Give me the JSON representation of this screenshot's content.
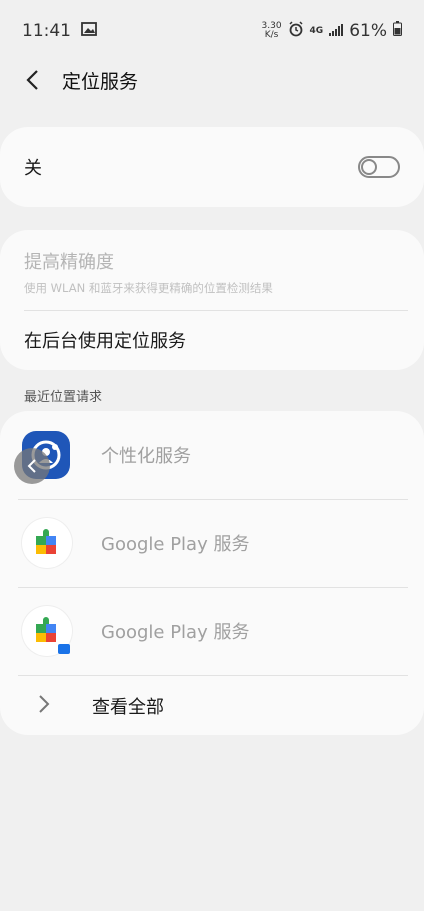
{
  "status_bar": {
    "time": "11:41",
    "net_speed_value": "3.30",
    "net_speed_unit": "K/s",
    "network_type": "4G",
    "battery": "61%"
  },
  "app_bar": {
    "title": "定位服务"
  },
  "location_toggle": {
    "label": "关",
    "state": "off"
  },
  "accuracy": {
    "title": "提高精确度",
    "subtitle": "使用 WLAN 和蓝牙来获得更精确的位置检测结果"
  },
  "background_use": {
    "label": "在后台使用定位服务"
  },
  "recent_requests": {
    "section_label": "最近位置请求",
    "apps": [
      {
        "name": "个性化服务",
        "icon": "personalization-icon"
      },
      {
        "name": "Google Play 服务",
        "icon": "google-play-services-icon"
      },
      {
        "name": "Google Play 服务",
        "icon": "google-play-services-work-icon"
      }
    ],
    "view_all": "查看全部"
  },
  "colors": {
    "background": "#f0f0f0",
    "card": "#fafafa",
    "disabled_text": "#b5b5b5",
    "samsung_blue": "#1f56b8"
  }
}
